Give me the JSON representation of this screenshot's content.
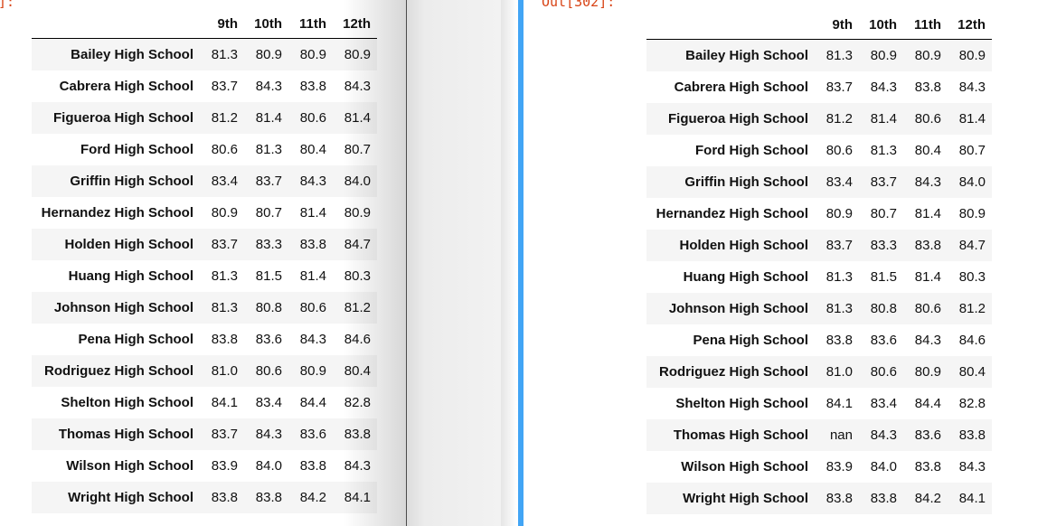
{
  "left_cell": {
    "prompt": "]:",
    "columns": [
      "9th",
      "10th",
      "11th",
      "12th"
    ],
    "rows": [
      {
        "school": "Bailey High School",
        "values": [
          "81.3",
          "80.9",
          "80.9",
          "80.9"
        ]
      },
      {
        "school": "Cabrera High School",
        "values": [
          "83.7",
          "84.3",
          "83.8",
          "84.3"
        ]
      },
      {
        "school": "Figueroa High School",
        "values": [
          "81.2",
          "81.4",
          "80.6",
          "81.4"
        ]
      },
      {
        "school": "Ford High School",
        "values": [
          "80.6",
          "81.3",
          "80.4",
          "80.7"
        ]
      },
      {
        "school": "Griffin High School",
        "values": [
          "83.4",
          "83.7",
          "84.3",
          "84.0"
        ]
      },
      {
        "school": "Hernandez High School",
        "values": [
          "80.9",
          "80.7",
          "81.4",
          "80.9"
        ]
      },
      {
        "school": "Holden High School",
        "values": [
          "83.7",
          "83.3",
          "83.8",
          "84.7"
        ]
      },
      {
        "school": "Huang High School",
        "values": [
          "81.3",
          "81.5",
          "81.4",
          "80.3"
        ]
      },
      {
        "school": "Johnson High School",
        "values": [
          "81.3",
          "80.8",
          "80.6",
          "81.2"
        ]
      },
      {
        "school": "Pena High School",
        "values": [
          "83.8",
          "83.6",
          "84.3",
          "84.6"
        ]
      },
      {
        "school": "Rodriguez High School",
        "values": [
          "81.0",
          "80.6",
          "80.9",
          "80.4"
        ]
      },
      {
        "school": "Shelton High School",
        "values": [
          "84.1",
          "83.4",
          "84.4",
          "82.8"
        ]
      },
      {
        "school": "Thomas High School",
        "values": [
          "83.7",
          "84.3",
          "83.6",
          "83.8"
        ]
      },
      {
        "school": "Wilson High School",
        "values": [
          "83.9",
          "84.0",
          "83.8",
          "84.3"
        ]
      },
      {
        "school": "Wright High School",
        "values": [
          "83.8",
          "83.8",
          "84.2",
          "84.1"
        ]
      }
    ]
  },
  "right_cell": {
    "prompt": "Out[302]:",
    "columns": [
      "9th",
      "10th",
      "11th",
      "12th"
    ],
    "rows": [
      {
        "school": "Bailey High School",
        "values": [
          "81.3",
          "80.9",
          "80.9",
          "80.9"
        ]
      },
      {
        "school": "Cabrera High School",
        "values": [
          "83.7",
          "84.3",
          "83.8",
          "84.3"
        ]
      },
      {
        "school": "Figueroa High School",
        "values": [
          "81.2",
          "81.4",
          "80.6",
          "81.4"
        ]
      },
      {
        "school": "Ford High School",
        "values": [
          "80.6",
          "81.3",
          "80.4",
          "80.7"
        ]
      },
      {
        "school": "Griffin High School",
        "values": [
          "83.4",
          "83.7",
          "84.3",
          "84.0"
        ]
      },
      {
        "school": "Hernandez High School",
        "values": [
          "80.9",
          "80.7",
          "81.4",
          "80.9"
        ]
      },
      {
        "school": "Holden High School",
        "values": [
          "83.7",
          "83.3",
          "83.8",
          "84.7"
        ]
      },
      {
        "school": "Huang High School",
        "values": [
          "81.3",
          "81.5",
          "81.4",
          "80.3"
        ]
      },
      {
        "school": "Johnson High School",
        "values": [
          "81.3",
          "80.8",
          "80.6",
          "81.2"
        ]
      },
      {
        "school": "Pena High School",
        "values": [
          "83.8",
          "83.6",
          "84.3",
          "84.6"
        ]
      },
      {
        "school": "Rodriguez High School",
        "values": [
          "81.0",
          "80.6",
          "80.9",
          "80.4"
        ]
      },
      {
        "school": "Shelton High School",
        "values": [
          "84.1",
          "83.4",
          "84.4",
          "82.8"
        ]
      },
      {
        "school": "Thomas High School",
        "values": [
          "nan",
          "84.3",
          "83.6",
          "83.8"
        ]
      },
      {
        "school": "Wilson High School",
        "values": [
          "83.9",
          "84.0",
          "83.8",
          "84.3"
        ]
      },
      {
        "school": "Wright High School",
        "values": [
          "83.8",
          "83.8",
          "84.2",
          "84.1"
        ]
      }
    ]
  },
  "colors": {
    "prompt_color": "#d84315",
    "cell_indicator": "#42a5f5",
    "row_stripe": "#f5f5f5"
  }
}
